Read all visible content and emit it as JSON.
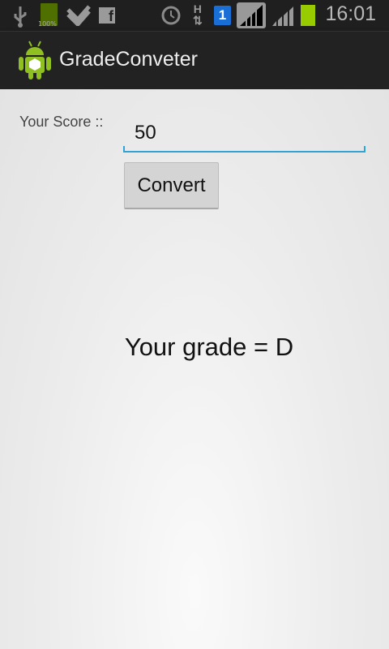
{
  "status_bar": {
    "time": "16:01",
    "battery_notification_label": "100%",
    "icons": [
      "usb-icon",
      "battery-full-icon",
      "check-icon",
      "facebook-icon",
      "alarm-icon",
      "hsdpa-data-icon",
      "sim-1-icon",
      "signal-sim1-icon",
      "signal-sim2-icon",
      "battery-icon"
    ]
  },
  "action_bar": {
    "title": "GradeConveter",
    "app_icon": "android-icon"
  },
  "form": {
    "score_label": "Your Score ::",
    "score_value": "50",
    "convert_label": "Convert"
  },
  "result": {
    "text": "Your grade = D"
  },
  "colors": {
    "accent": "#33a3d4",
    "battery": "#99cc00"
  }
}
